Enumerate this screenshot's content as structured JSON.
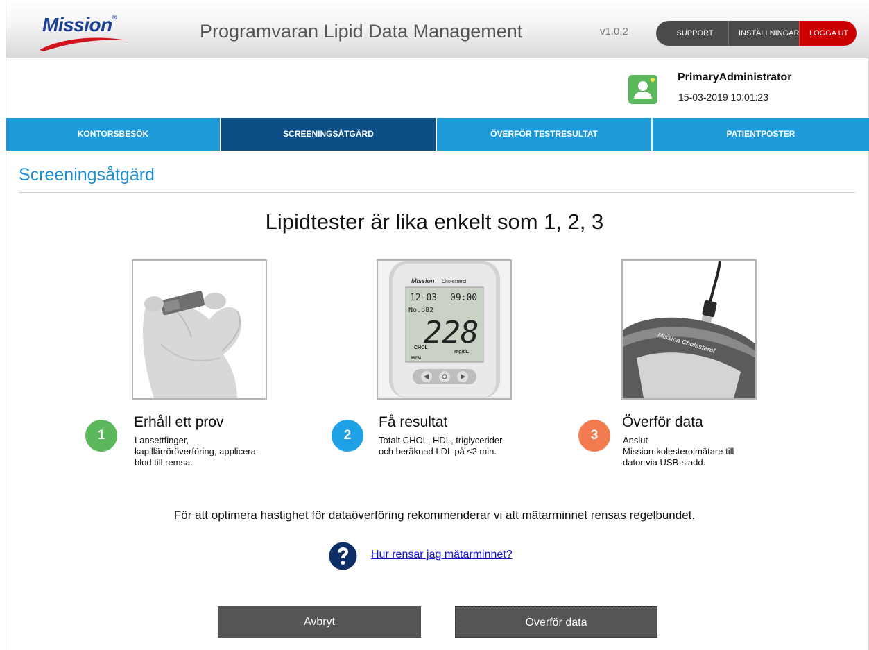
{
  "header": {
    "logo_text": "Mission",
    "logo_mark": "®",
    "app_title": "Programvaran Lipid Data Management",
    "version": "v1.0.2",
    "buttons": {
      "support": "SUPPORT",
      "settings": "INSTÄLLNINGAR",
      "logout": "LOGGA UT"
    }
  },
  "user": {
    "name": "PrimaryAdministrator",
    "datetime": "15-03-2019 10:01:23",
    "avatar_icon": "user-icon",
    "avatar_color": "#5cb85c"
  },
  "nav": {
    "items": [
      {
        "label": "KONTORSBESÖK",
        "active": false
      },
      {
        "label": "SCREENINGSÅTGÄRD",
        "active": true
      },
      {
        "label": "ÖVERFÖR TESTRESULTAT",
        "active": false
      },
      {
        "label": "PATIENTPOSTER",
        "active": false
      }
    ],
    "color": "#1e9ad8",
    "active_color": "#0b4f86"
  },
  "page": {
    "title": "Screeningsåtgärd",
    "headline": "Lipidtester är lika enkelt som 1, 2, 3"
  },
  "steps": [
    {
      "number": "1",
      "title": "Erhåll ett prov",
      "desc_lines": [
        "Lansettfinger,",
        "kapillärröröverföring, applicera",
        "blod till remsa."
      ],
      "color": "#5cb85c",
      "image_icon": "test-strip-in-fingers"
    },
    {
      "number": "2",
      "title": "Få resultat",
      "desc_lines": [
        "Totalt CHOL, HDL, triglycerider",
        "och beräknad LDL på ≤2 min."
      ],
      "color": "#1ea1e6",
      "image_icon": "cholesterol-meter-display",
      "meter": {
        "brand": "Mission",
        "model": "Cholesterol",
        "date": "12-03",
        "time": "09:00",
        "record": "No.b82",
        "value": "228",
        "analyte": "CHOL",
        "unit": "mg/dL",
        "mem": "MEM"
      }
    },
    {
      "number": "3",
      "title": "Överför data",
      "desc_lines": [
        "Anslut",
        "Mission-kolesterolmätare till",
        "dator via USB-sladd."
      ],
      "color": "#f27b50",
      "image_icon": "meter-usb-cable",
      "meter_label": "Mission Cholesterol"
    }
  ],
  "note": "För att optimera hastighet för dataöverföring rekommenderar vi att mätarminnet rensas regelbundet.",
  "help": {
    "icon": "question-circle-icon",
    "link": "Hur rensar jag mätarminnet?"
  },
  "actions": {
    "cancel": "Avbryt",
    "transfer": "Överför data"
  }
}
